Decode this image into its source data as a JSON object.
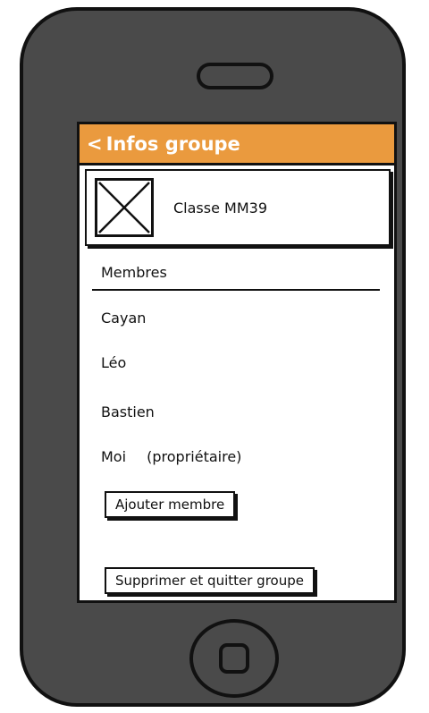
{
  "header": {
    "back_glyph": "<",
    "title": "Infos groupe"
  },
  "group": {
    "name": "Classe MM39",
    "avatar_icon": "image-placeholder-icon"
  },
  "members": {
    "header": "Membres",
    "items": [
      {
        "name": "Cayan"
      },
      {
        "name": "Léo"
      },
      {
        "name": "Bastien"
      },
      {
        "name": "Moi",
        "role": "(propriétaire)"
      }
    ]
  },
  "actions": {
    "add_member": "Ajouter membre",
    "delete_leave": "Supprimer et quitter groupe"
  },
  "colors": {
    "header_bg": "#ea9a3e",
    "phone_body": "#4a4a4a"
  }
}
